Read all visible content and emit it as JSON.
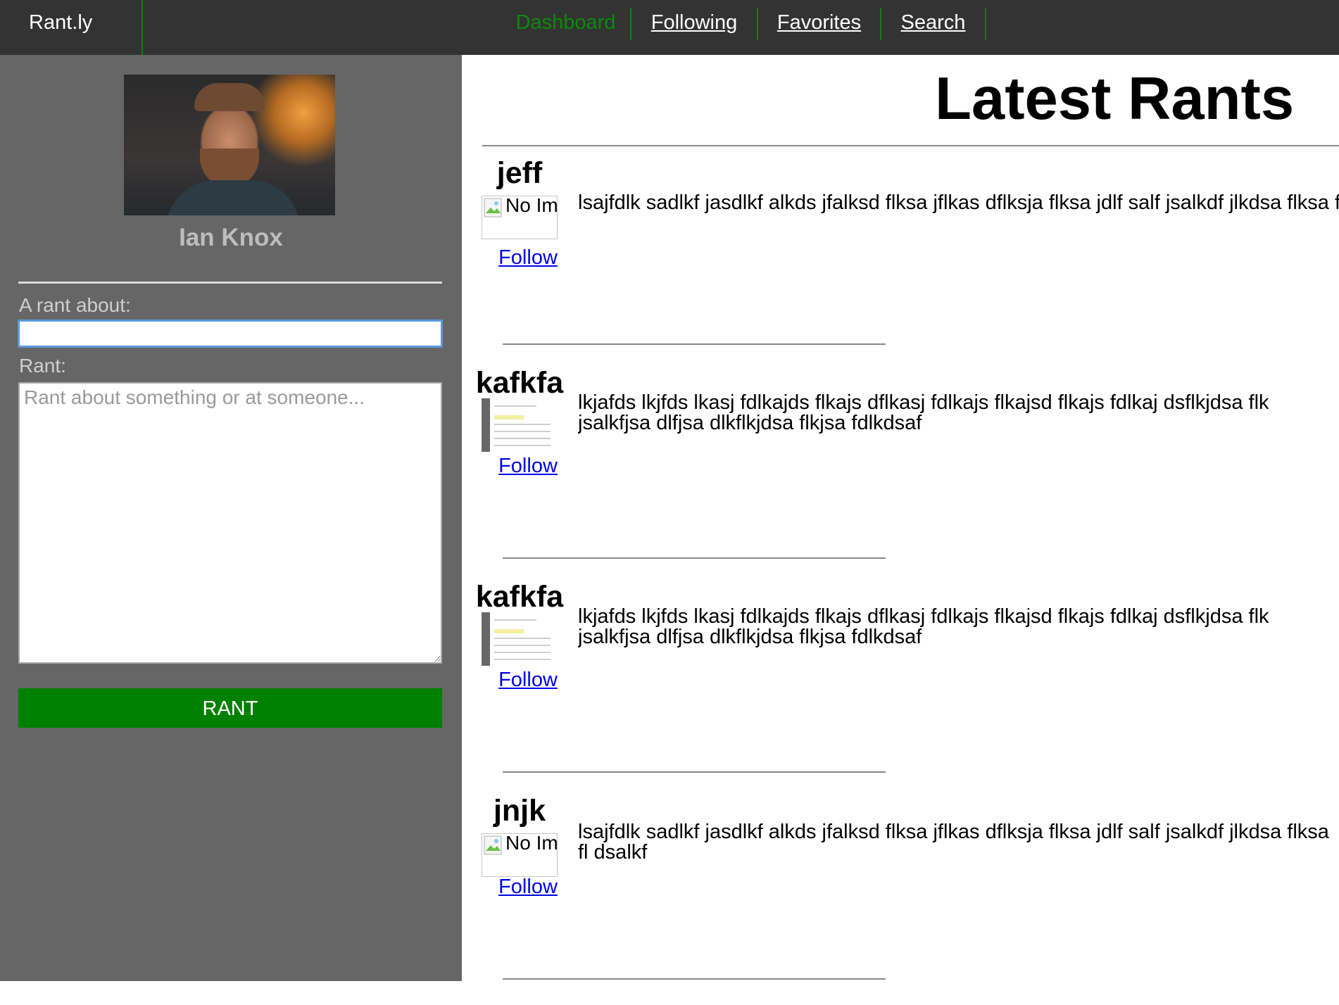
{
  "app": {
    "brand": "Rant.ly"
  },
  "nav": {
    "items": [
      {
        "label": "Dashboard",
        "active": true
      },
      {
        "label": "Following",
        "active": false
      },
      {
        "label": "Favorites",
        "active": false
      },
      {
        "label": "Search",
        "active": false
      }
    ]
  },
  "sidebar": {
    "username": "Ian Knox",
    "about_label": "A rant about:",
    "about_value": "",
    "rant_label": "Rant:",
    "rant_placeholder": "Rant about something or at someone...",
    "submit_label": "RANT"
  },
  "main": {
    "title": "Latest Rants",
    "posts": [
      {
        "author": "jeff",
        "image": "No Image",
        "follow_label": "Follow",
        "text": "lsajfdlk sadlkf jasdlkf alkds jfalksd flksa jflkas dflksja flksa jdlf salf jsalkdf jlkdsa flksa fl"
      },
      {
        "author": "kafkfa",
        "image": "screenshot-thumbnail",
        "follow_label": "Follow",
        "text": "lkjafds lkjfds lkasj fdlkajds flkajs dflkasj fdlkajs flkajsd flkajs fdlkaj dsflkjdsa flk jsalkfjsa dlfjsa dlkflkjdsa flkjsa fdlkdsaf"
      },
      {
        "author": "kafkfa",
        "image": "screenshot-thumbnail",
        "follow_label": "Follow",
        "text": "lkjafds lkjfds lkasj fdlkajds flkajs dflkasj fdlkajs flkajsd flkajs fdlkaj dsflkjdsa flk jsalkfjsa dlfjsa dlkflkjdsa flkjsa fdlkdsaf"
      },
      {
        "author": "jnjk",
        "image": "No Image",
        "follow_label": "Follow",
        "text": "lsajfdlk sadlkf jasdlkf alkds jfalksd flksa jflkas dflksja flksa jdlf salf jsalkdf jlkdsa flksa fl dsalkf"
      }
    ]
  },
  "colors": {
    "topbar": "#333333",
    "sidebar": "#666666",
    "accent": "#008000",
    "nav_active": "#0c8a0c",
    "link": "#0000ee"
  }
}
